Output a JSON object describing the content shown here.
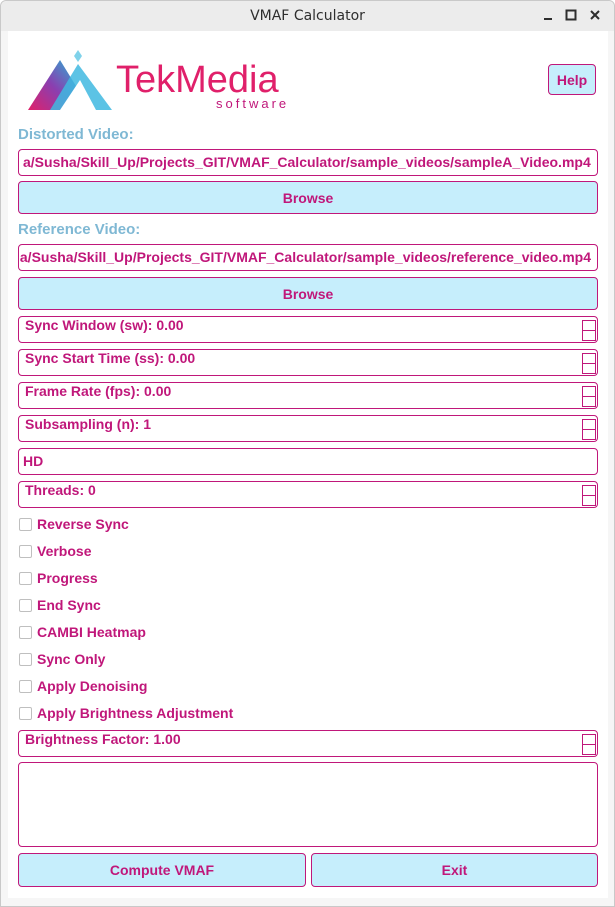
{
  "window": {
    "title": "VMAF Calculator"
  },
  "logo": {
    "brand_main": "TekMedia",
    "brand_sub": "software"
  },
  "header": {
    "help_label": "Help"
  },
  "distorted": {
    "label": "Distorted Video:",
    "path": "a/Susha/Skill_Up/Projects_GIT/VMAF_Calculator/sample_videos/sampleA_Video.mp4",
    "browse_label": "Browse"
  },
  "reference": {
    "label": "Reference Video:",
    "path": "a/Susha/Skill_Up/Projects_GIT/VMAF_Calculator/sample_videos/reference_video.mp4",
    "browse_label": "Browse"
  },
  "settings": {
    "sync_window": "Sync Window (sw): 0.00",
    "sync_start": "Sync Start Time (ss): 0.00",
    "frame_rate": "Frame Rate (fps): 0.00",
    "subsampling": "Subsampling (n): 1",
    "model": "HD",
    "threads": "Threads: 0",
    "brightness_factor": "Brightness Factor: 1.00"
  },
  "options": [
    {
      "label": "Reverse Sync",
      "checked": false
    },
    {
      "label": "Verbose",
      "checked": false
    },
    {
      "label": "Progress",
      "checked": false
    },
    {
      "label": "End Sync",
      "checked": false
    },
    {
      "label": "CAMBI Heatmap",
      "checked": false
    },
    {
      "label": "Sync Only",
      "checked": false
    },
    {
      "label": "Apply Denoising",
      "checked": false
    },
    {
      "label": "Apply Brightness Adjustment",
      "checked": false
    }
  ],
  "actions": {
    "compute_label": "Compute VMAF",
    "exit_label": "Exit"
  },
  "colors": {
    "accent": "#c0177a",
    "button_bg": "#c6eefc",
    "section_label": "#7fb8d4"
  }
}
